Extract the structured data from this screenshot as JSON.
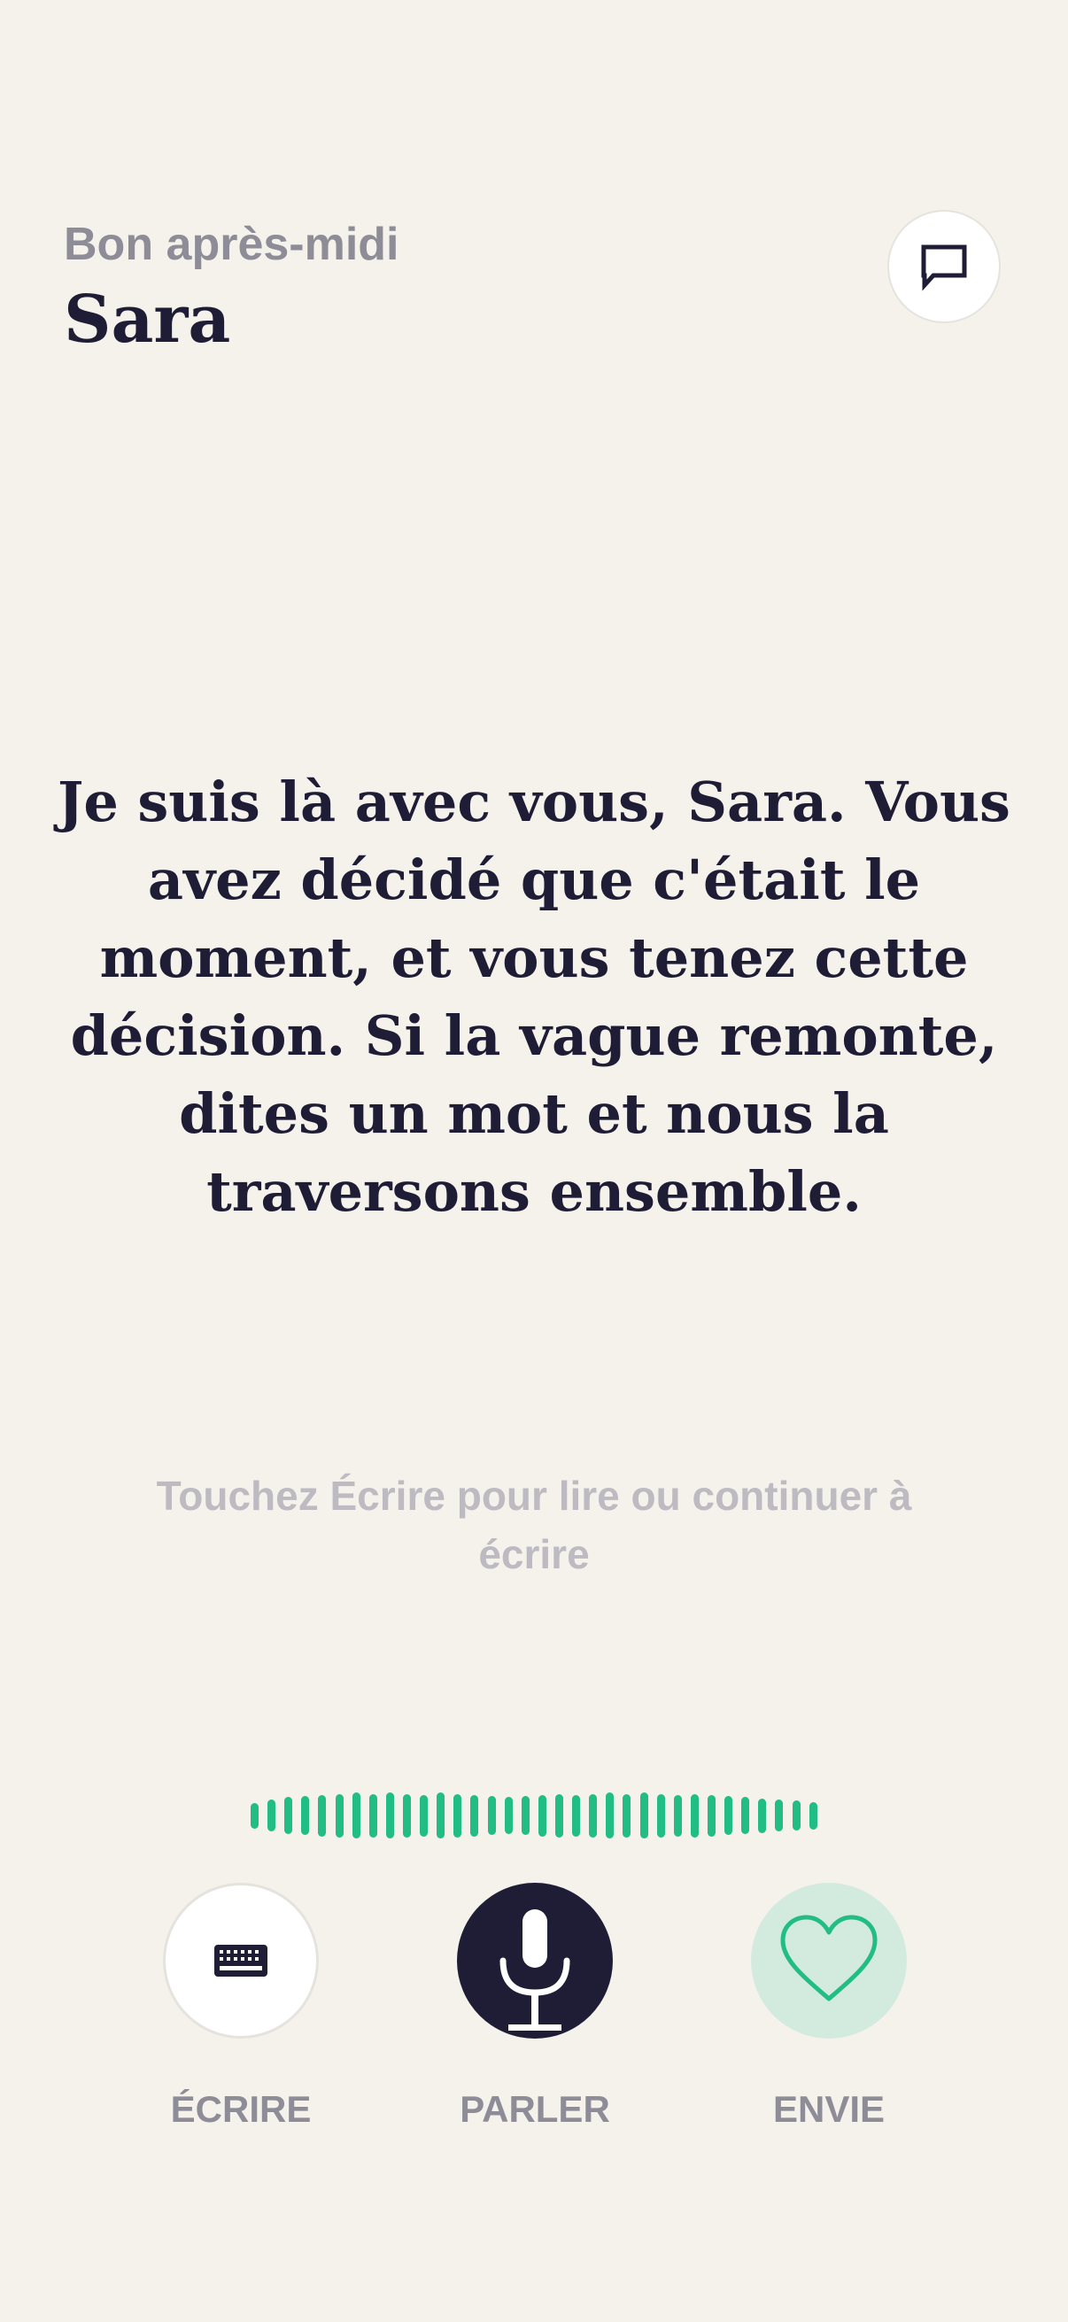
{
  "header": {
    "greeting": "Bon après-midi",
    "user_name": "Sara",
    "chat_icon": "chat-bubble-icon"
  },
  "message": {
    "text": "Je suis là avec vous, Sara. Vous avez décidé que c'était le moment, et vous tenez cette décision. Si la vague remonte, dites un mot et nous la traversons ensemble."
  },
  "hint": {
    "text": "Touchez Écrire pour lire ou continuer à écrire"
  },
  "waveform": {
    "color": "#22bd84",
    "levels": [
      0.55,
      0.7,
      0.8,
      0.85,
      0.9,
      0.95,
      1.0,
      0.95,
      1.0,
      0.95,
      0.9,
      1.0,
      0.95,
      0.9,
      0.85,
      0.8,
      0.85,
      0.9,
      0.95,
      0.9,
      0.95,
      1.0,
      0.95,
      1.0,
      0.95,
      0.9,
      0.95,
      0.9,
      0.85,
      0.8,
      0.75,
      0.7,
      0.65,
      0.6
    ]
  },
  "actions": {
    "write": {
      "label": "ÉCRIRE",
      "icon": "keyboard-icon"
    },
    "speak": {
      "label": "PARLER",
      "icon": "microphone-icon"
    },
    "crave": {
      "label": "ENVIE",
      "icon": "heart-icon"
    }
  },
  "colors": {
    "background": "#f5f2ec",
    "primary_dark": "#1f1c35",
    "accent_green": "#22bd84",
    "muted_text": "#8e8c97"
  }
}
